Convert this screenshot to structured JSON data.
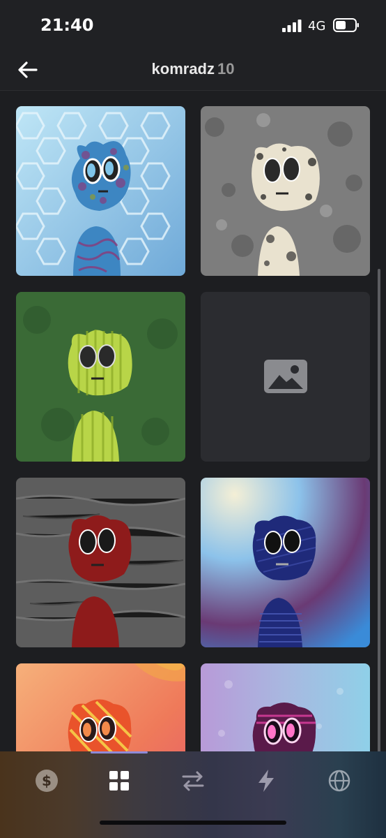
{
  "status_bar": {
    "time": "21:40",
    "network": "4G"
  },
  "header": {
    "title": "komradz",
    "count": "10"
  },
  "grid": {
    "items": [
      {
        "name": "hex-blue-komrad",
        "bg": "#9ad7ea",
        "accent": "#3a7ab8"
      },
      {
        "name": "stone-gray-komrad",
        "bg": "#7a7a7a",
        "accent": "#e8e1cf"
      },
      {
        "name": "green-stripe-komrad",
        "bg": "#3d6b3a",
        "accent": "#b7d24a"
      },
      {
        "name": "placeholder",
        "bg": "#2b2c30",
        "accent": "#8a8b8f"
      },
      {
        "name": "red-gray-komrad",
        "bg": "#5a5a5a",
        "accent": "#8a1a1a"
      },
      {
        "name": "navy-gradient-komrad",
        "bg": "#6fb4e4",
        "accent": "#1d2a78"
      },
      {
        "name": "orange-stripe-komrad",
        "bg": "#f08a54",
        "accent": "#e9532b"
      },
      {
        "name": "purple-pink-komrad",
        "bg": "#9fc3e8",
        "accent": "#d23c98"
      }
    ]
  },
  "tabbar": {
    "tabs": [
      {
        "icon": "dollar-icon",
        "active": false
      },
      {
        "icon": "grid-icon",
        "active": true
      },
      {
        "icon": "swap-arrows-icon",
        "active": false
      },
      {
        "icon": "lightning-icon",
        "active": false
      },
      {
        "icon": "globe-icon",
        "active": false
      }
    ]
  },
  "colors": {
    "background": "#202124",
    "card_placeholder": "#2b2c30",
    "indicator": "#8e8ad8"
  }
}
